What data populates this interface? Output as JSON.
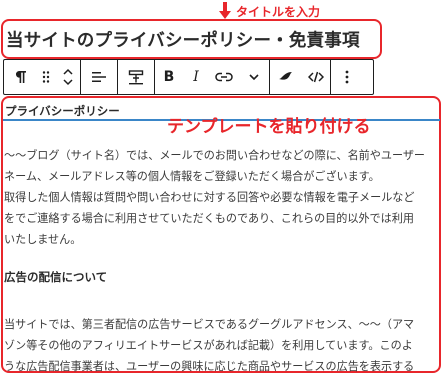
{
  "annotations": {
    "title_hint": "タイトルを入力",
    "paste_hint": "テンプレートを貼り付ける",
    "accent_color": "#e8262b"
  },
  "editor": {
    "title": "当サイトのプライバシーポリシー・免責事項",
    "toolbar": {
      "buttons": [
        {
          "name": "paragraph",
          "icon": "paragraph-icon"
        },
        {
          "name": "drag",
          "icon": "drag-handle-icon"
        },
        {
          "name": "move",
          "icon": "move-up-down-icon"
        },
        {
          "name": "align",
          "icon": "align-icon"
        },
        {
          "name": "highlight",
          "icon": "highlight-icon"
        },
        {
          "name": "bold",
          "label": "B"
        },
        {
          "name": "italic",
          "label": "I"
        },
        {
          "name": "link",
          "icon": "link-icon"
        },
        {
          "name": "more-formats",
          "icon": "chevron-down-icon"
        },
        {
          "name": "marker",
          "icon": "marker-icon"
        },
        {
          "name": "code",
          "icon": "code-icon"
        },
        {
          "name": "options",
          "icon": "more-vertical-icon"
        }
      ]
    },
    "content": {
      "heading_privacy": "プライバシーポリシー",
      "paragraph_1": [
        "～～ブログ（サイト名）では、メールでのお問い合わせなどの際に、名前やユーザー",
        "ネーム、メールアドレス等の個人情報をご登録いただく場合がございます。",
        "取得した個人情報は質問や問い合わせに対する回答や必要な情報を電子メールなど",
        "をでご連絡する場合に利用させていただくものであり、これらの目的以外では利用",
        "いたしません。"
      ],
      "heading_ads": "広告の配信について",
      "paragraph_2": [
        "当サイトでは、第三者配信の広告サービスであるグーグルアドセンス、～～（アマ",
        "ゾン等その他のアフィリエイトサービスがあれば記載）を利用しています。このよ",
        "うな広告配信事業者は、ユーザーの興味に応じた商品やサービスの広告を表示する"
      ]
    }
  }
}
